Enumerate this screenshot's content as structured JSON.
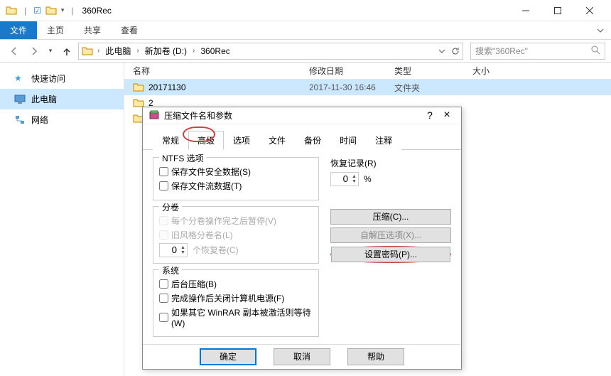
{
  "titlebar": {
    "title": "360Rec"
  },
  "ribbon": {
    "file": "文件",
    "tabs": [
      "主页",
      "共享",
      "查看"
    ]
  },
  "nav": {
    "crumbs": [
      "此电脑",
      "新加卷 (D:)",
      "360Rec"
    ],
    "search_placeholder": "搜索\"360Rec\""
  },
  "sidebar": {
    "items": [
      {
        "label": "快速访问"
      },
      {
        "label": "此电脑"
      },
      {
        "label": "网络"
      }
    ]
  },
  "columns": {
    "name": "名称",
    "date": "修改日期",
    "type": "类型",
    "size": "大小"
  },
  "rows": [
    {
      "name": "20171130",
      "date": "2017-11-30 16:46",
      "type": "文件夹"
    },
    {
      "name": "2",
      "date": "",
      "type": ""
    },
    {
      "name": "2",
      "date": "",
      "type": ""
    }
  ],
  "dialog": {
    "title": "压缩文件名和参数",
    "tabs": [
      "常规",
      "高级",
      "选项",
      "文件",
      "备份",
      "时间",
      "注释"
    ],
    "active_tab_index": 1,
    "ntfs": {
      "title": "NTFS 选项",
      "save_security": "保存文件安全数据(S)",
      "save_streams": "保存文件流数据(T)"
    },
    "volume": {
      "title": "分卷",
      "pause_after": "每个分卷操作完之后暂停(V)",
      "old_style": "旧风格分卷名(L)",
      "recovery_label": "个恢复卷(C)",
      "recovery_value": "0"
    },
    "system": {
      "title": "系统",
      "background": "后台压缩(B)",
      "shutdown": "完成操作后关闭计算机电源(F)",
      "wait_other": "如果其它 WinRAR 副本被激活则等待(W)"
    },
    "recovery_record": {
      "title": "恢复记录(R)",
      "value": "0",
      "unit": "%"
    },
    "buttons": {
      "compress": "压缩(C)...",
      "sfx": "自解压选项(X)...",
      "password": "设置密码(P)..."
    },
    "footer": {
      "ok": "确定",
      "cancel": "取消",
      "help": "帮助"
    }
  }
}
